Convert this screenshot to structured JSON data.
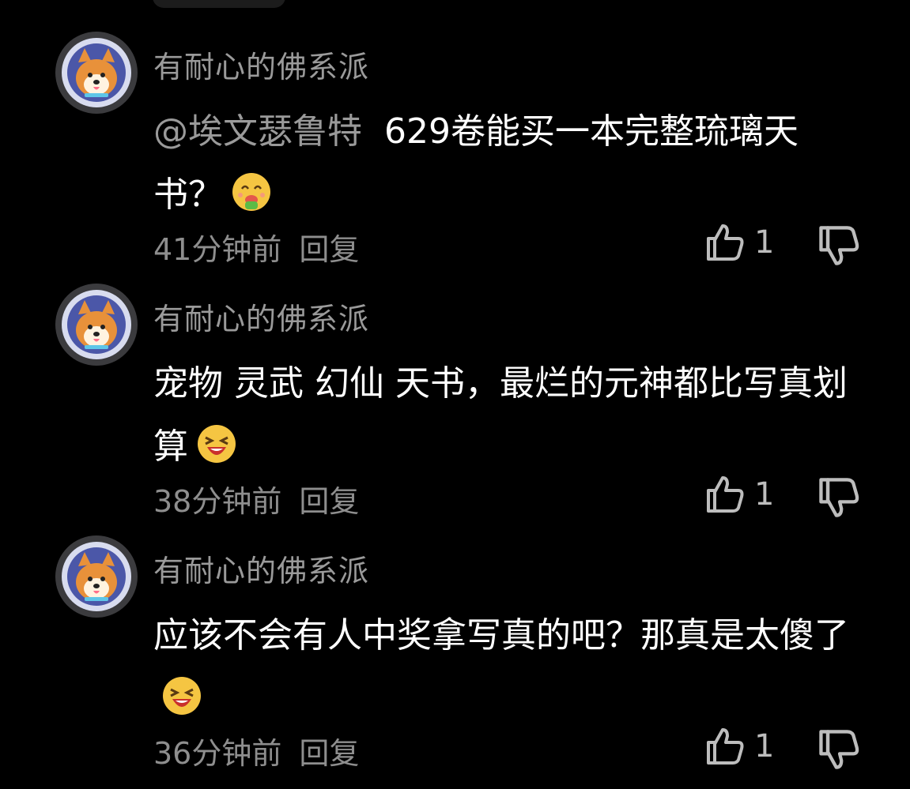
{
  "comments": [
    {
      "author": "有耐心的佛系派",
      "mention": "@埃文瑟鲁特",
      "text": "629卷能买一本完整琉璃天书？",
      "emoji": "drooling-emoji",
      "time": "41分钟前",
      "reply_label": "回复",
      "likes": "1"
    },
    {
      "author": "有耐心的佛系派",
      "mention": "",
      "text": "宠物 灵武 幻仙 天书，最烂的元神都比写真划算",
      "emoji": "laughing-emoji",
      "time": "38分钟前",
      "reply_label": "回复",
      "likes": "1"
    },
    {
      "author": "有耐心的佛系派",
      "mention": "",
      "text": "应该不会有人中奖拿写真的吧？那真是太傻了",
      "emoji": "laughing-emoji",
      "time": "36分钟前",
      "reply_label": "回复",
      "likes": "1"
    }
  ],
  "icons": {
    "like": "thumbs-up-icon",
    "dislike": "thumbs-down-icon"
  },
  "colors": {
    "background": "#000000",
    "meta": "#8e8e8e",
    "text": "#ffffff"
  }
}
